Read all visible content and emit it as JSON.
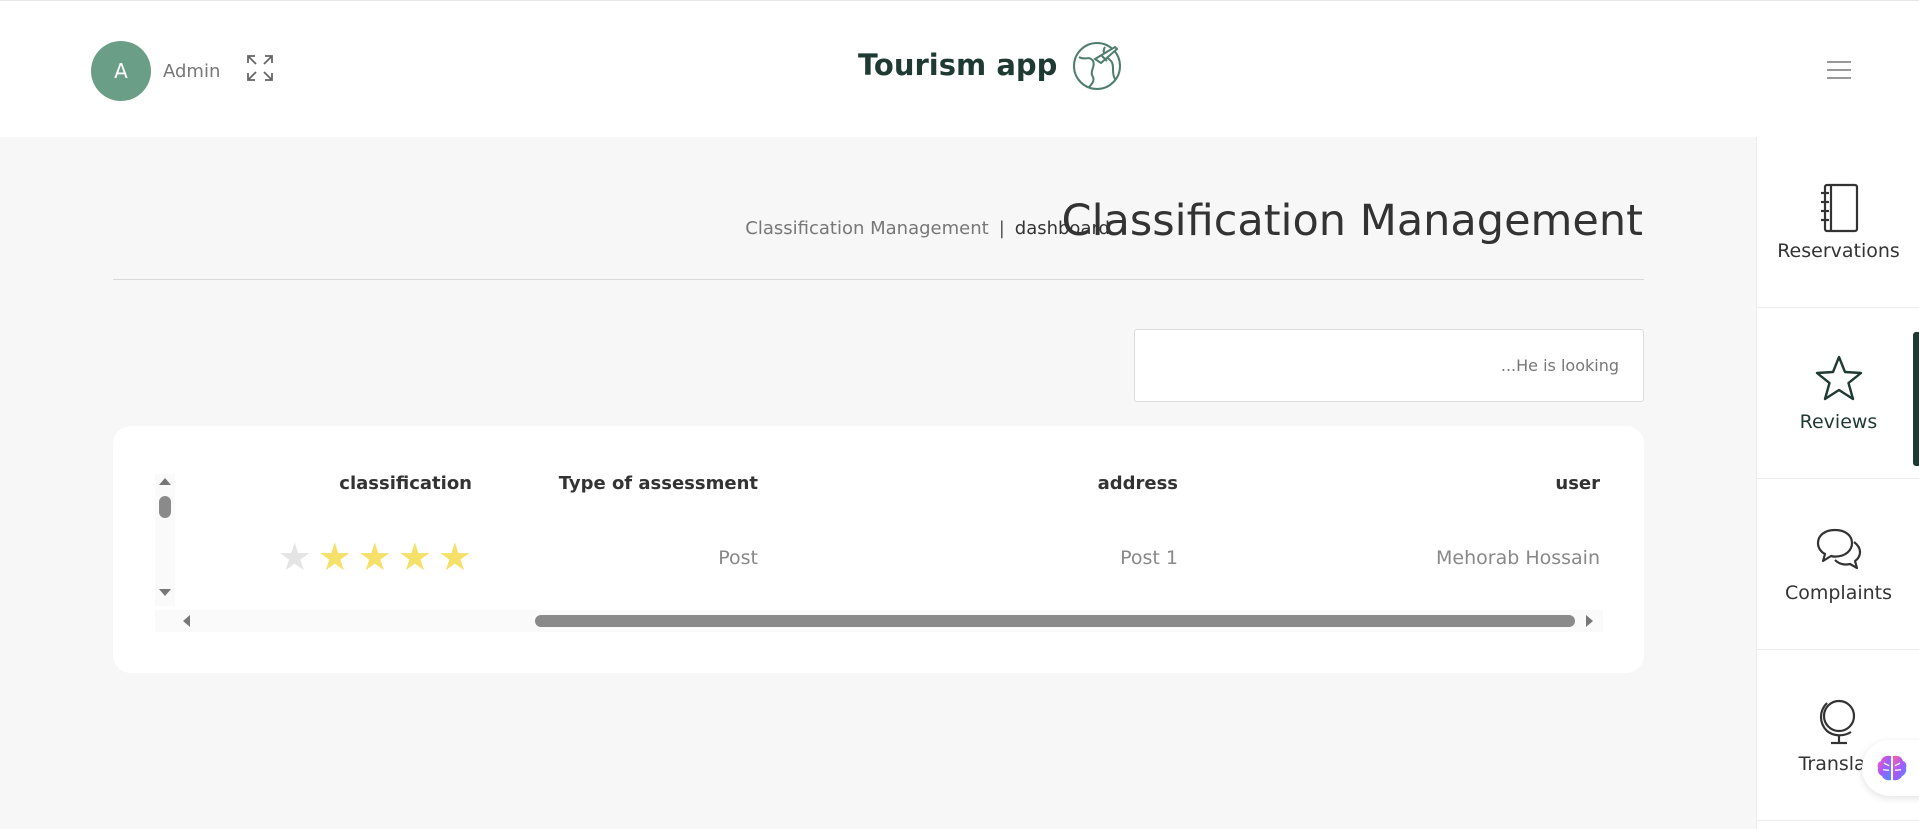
{
  "header": {
    "avatar_initial": "A",
    "user_name": "Admin",
    "app_title": "Tourism app",
    "icons": {
      "expand": "expand-icon",
      "logo": "globe-plane-logo-icon",
      "menu": "hamburger-menu-icon"
    }
  },
  "breadcrumb": {
    "section": "Classification Management",
    "separator": "|",
    "current": "dashboard"
  },
  "page": {
    "title": "Classification Management"
  },
  "search": {
    "placeholder": "...He is looking",
    "value": ""
  },
  "table": {
    "columns": {
      "user": "user",
      "address": "address",
      "type": "Type of assessment",
      "classification": "classification"
    },
    "rows": [
      {
        "user": "Mehorab Hossain",
        "address": "Post 1",
        "type": "Post",
        "rating": 4,
        "max_rating": 5
      }
    ]
  },
  "sidebar": {
    "items": [
      {
        "label": "Reservations",
        "icon": "notebook-icon",
        "active": false
      },
      {
        "label": "Reviews",
        "icon": "star-icon",
        "active": true
      },
      {
        "label": "Complaints",
        "icon": "chat-bubbles-icon",
        "active": false
      },
      {
        "label": "Translati",
        "icon": "globe-icon",
        "active": false
      }
    ]
  },
  "colors": {
    "accent": "#1f3a33",
    "avatar": "#6a9e87",
    "star": "#f5e06a",
    "star_empty": "#e4e4e4"
  }
}
